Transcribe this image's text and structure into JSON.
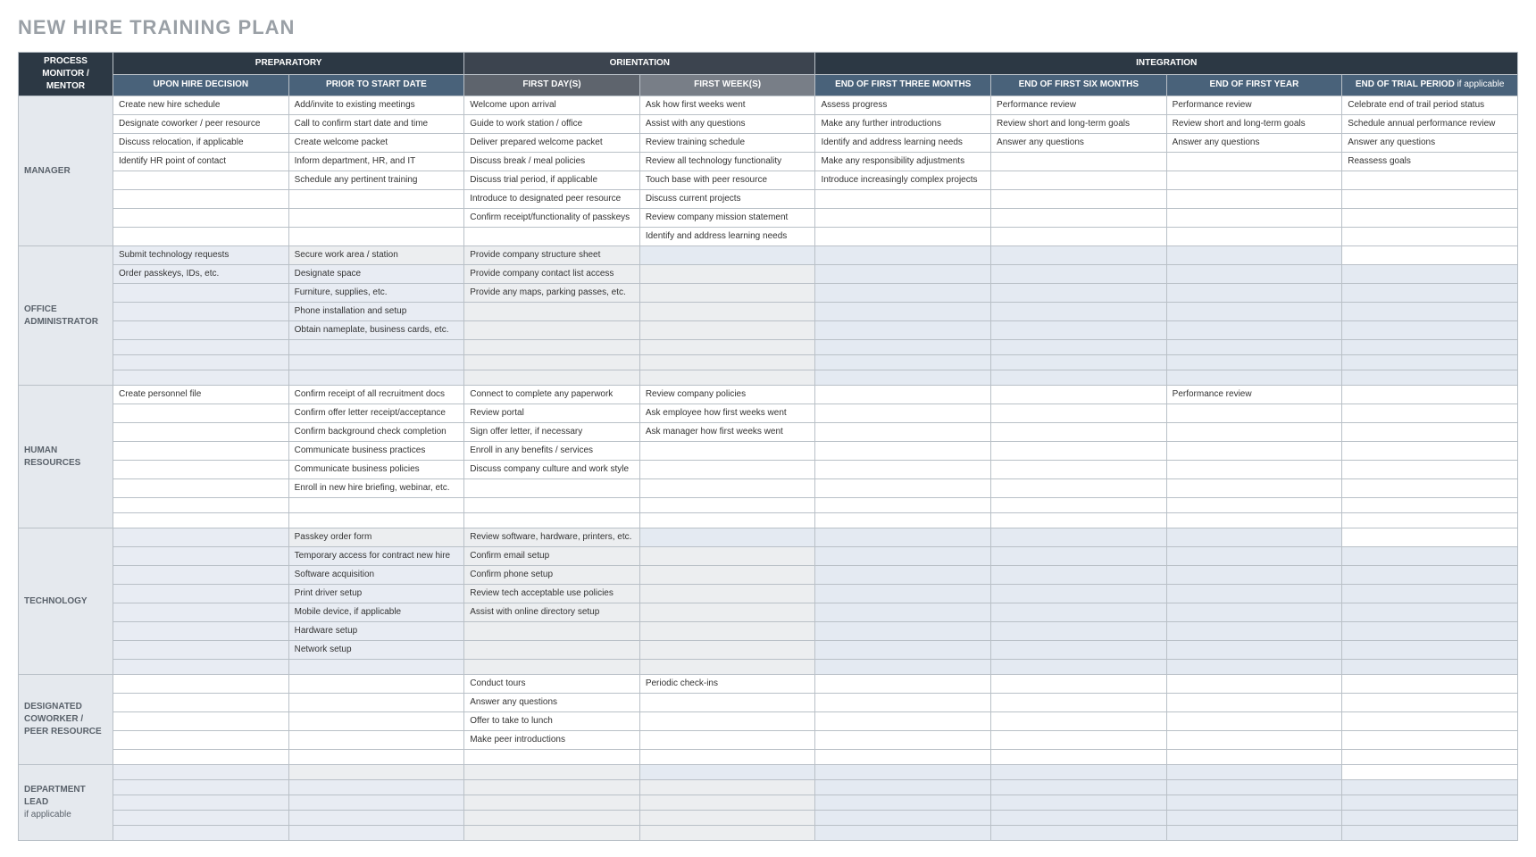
{
  "title": "NEW HIRE TRAINING PLAN",
  "corner": "PROCESS MONITOR / MENTOR",
  "groupHeaders": {
    "prep": "PREPARATORY",
    "orient": "ORIENTATION",
    "integ": "INTEGRATION"
  },
  "subHeaders": {
    "c1": "UPON HIRE DECISION",
    "c2": "PRIOR TO START DATE",
    "c3": "FIRST DAY(S)",
    "c4": "FIRST WEEK(S)",
    "c5": "END OF FIRST THREE MONTHS",
    "c6": "END OF FIRST SIX MONTHS",
    "c7": "END OF FIRST YEAR",
    "c8_a": "END OF TRIAL PERIOD",
    "c8_b": " if applicable"
  },
  "sections": [
    {
      "label": "MANAGER",
      "shaded": false,
      "rows": [
        [
          "Create new hire schedule",
          "Add/invite to existing meetings",
          "Welcome upon arrival",
          "Ask how first weeks went",
          "Assess progress",
          "Performance review",
          "Performance review",
          "Celebrate end of trail period status"
        ],
        [
          "Designate coworker / peer resource",
          "Call to confirm start date and time",
          "Guide to work station / office",
          "Assist with any questions",
          "Make any further introductions",
          "Review short and long-term goals",
          "Review short and long-term goals",
          "Schedule annual performance review"
        ],
        [
          "Discuss relocation, if applicable",
          "Create welcome packet",
          "Deliver prepared welcome packet",
          "Review training schedule",
          "Identify and address learning needs",
          "Answer any questions",
          "Answer any questions",
          "Answer any questions"
        ],
        [
          "Identify HR point of contact",
          "Inform department, HR, and IT",
          "Discuss break / meal policies",
          "Review all technology functionality",
          "Make any responsibility adjustments",
          "",
          "",
          "Reassess goals"
        ],
        [
          "",
          "Schedule any pertinent training",
          "Discuss trial period, if applicable",
          "Touch base with peer resource",
          "Introduce increasingly complex projects",
          "",
          "",
          ""
        ],
        [
          "",
          "",
          "Introduce to designated peer resource",
          "Discuss current projects",
          "",
          "",
          "",
          ""
        ],
        [
          "",
          "",
          "Confirm receipt/functionality of passkeys",
          "Review company mission statement",
          "",
          "",
          "",
          ""
        ],
        [
          "",
          "",
          "",
          "Identify and address learning needs",
          "",
          "",
          "",
          ""
        ]
      ]
    },
    {
      "label": "OFFICE ADMINISTRATOR",
      "shaded": true,
      "rows": [
        [
          "Submit technology requests",
          "Secure work area / station",
          "Provide company structure sheet",
          "",
          "",
          "",
          "",
          ""
        ],
        [
          "Order passkeys, IDs, etc.",
          "Designate space",
          "Provide company contact list access",
          "",
          "",
          "",
          "",
          ""
        ],
        [
          "",
          "Furniture, supplies, etc.",
          "Provide any maps, parking passes, etc.",
          "",
          "",
          "",
          "",
          ""
        ],
        [
          "",
          "Phone installation and setup",
          "",
          "",
          "",
          "",
          "",
          ""
        ],
        [
          "",
          "Obtain nameplate, business cards, etc.",
          "",
          "",
          "",
          "",
          "",
          ""
        ],
        [
          "",
          "",
          "",
          "",
          "",
          "",
          "",
          ""
        ],
        [
          "",
          "",
          "",
          "",
          "",
          "",
          "",
          ""
        ],
        [
          "",
          "",
          "",
          "",
          "",
          "",
          "",
          ""
        ]
      ]
    },
    {
      "label": "HUMAN RESOURCES",
      "shaded": false,
      "rows": [
        [
          "Create personnel file",
          "Confirm receipt of all recruitment docs",
          "Connect to complete any paperwork",
          "Review company policies",
          "",
          "",
          "Performance review",
          ""
        ],
        [
          "",
          "Confirm offer letter receipt/acceptance",
          "Review portal",
          "Ask employee how first weeks went",
          "",
          "",
          "",
          ""
        ],
        [
          "",
          "Confirm background check completion",
          "Sign offer letter, if necessary",
          "Ask manager how first weeks went",
          "",
          "",
          "",
          ""
        ],
        [
          "",
          "Communicate business practices",
          "Enroll in any benefits / services",
          "",
          "",
          "",
          "",
          ""
        ],
        [
          "",
          "Communicate business policies",
          "Discuss company culture and work style",
          "",
          "",
          "",
          "",
          ""
        ],
        [
          "",
          "Enroll in new hire briefing, webinar, etc.",
          "",
          "",
          "",
          "",
          "",
          ""
        ],
        [
          "",
          "",
          "",
          "",
          "",
          "",
          "",
          ""
        ],
        [
          "",
          "",
          "",
          "",
          "",
          "",
          "",
          ""
        ]
      ]
    },
    {
      "label": "TECHNOLOGY",
      "shaded": true,
      "rows": [
        [
          "",
          "Passkey order form",
          "Review software, hardware, printers, etc.",
          "",
          "",
          "",
          "",
          ""
        ],
        [
          "",
          "Temporary access for contract new hire",
          "Confirm email setup",
          "",
          "",
          "",
          "",
          ""
        ],
        [
          "",
          "Software acquisition",
          "Confirm phone setup",
          "",
          "",
          "",
          "",
          ""
        ],
        [
          "",
          "Print driver setup",
          "Review tech acceptable use policies",
          "",
          "",
          "",
          "",
          ""
        ],
        [
          "",
          "Mobile device, if applicable",
          "Assist with online directory setup",
          "",
          "",
          "",
          "",
          ""
        ],
        [
          "",
          "Hardware setup",
          "",
          "",
          "",
          "",
          "",
          ""
        ],
        [
          "",
          "Network setup",
          "",
          "",
          "",
          "",
          "",
          ""
        ],
        [
          "",
          "",
          "",
          "",
          "",
          "",
          "",
          ""
        ]
      ]
    },
    {
      "label": "DESIGNATED COWORKER / PEER RESOURCE",
      "shaded": false,
      "rows": [
        [
          "",
          "",
          "Conduct tours",
          "Periodic check-ins",
          "",
          "",
          "",
          ""
        ],
        [
          "",
          "",
          "Answer any questions",
          "",
          "",
          "",
          "",
          ""
        ],
        [
          "",
          "",
          "Offer to take to lunch",
          "",
          "",
          "",
          "",
          ""
        ],
        [
          "",
          "",
          "Make peer introductions",
          "",
          "",
          "",
          "",
          ""
        ],
        [
          "",
          "",
          "",
          "",
          "",
          "",
          "",
          ""
        ]
      ]
    },
    {
      "label_a": "DEPARTMENT LEAD",
      "label_b": "if applicable",
      "shaded": true,
      "rows": [
        [
          "",
          "",
          "",
          "",
          "",
          "",
          "",
          ""
        ],
        [
          "",
          "",
          "",
          "",
          "",
          "",
          "",
          ""
        ],
        [
          "",
          "",
          "",
          "",
          "",
          "",
          "",
          ""
        ],
        [
          "",
          "",
          "",
          "",
          "",
          "",
          "",
          ""
        ],
        [
          "",
          "",
          "",
          "",
          "",
          "",
          "",
          ""
        ]
      ]
    }
  ]
}
